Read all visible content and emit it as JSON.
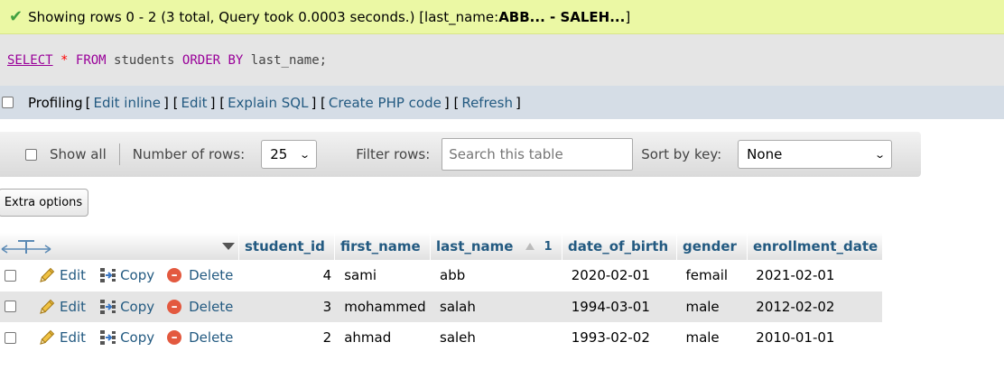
{
  "message": {
    "prefix": "Showing rows 0 - 2 (3 total, Query took 0.0003 seconds.) [last_name: ",
    "range": "ABB... - SALEH...",
    "suffix": "]"
  },
  "sql": {
    "select": "SELECT",
    "star": "*",
    "from": "FROM",
    "table": "students",
    "order_by": "ORDER BY",
    "column": "last_name;"
  },
  "profiling": {
    "label": "Profiling",
    "links": [
      "Edit inline",
      "Edit",
      "Explain SQL",
      "Create PHP code",
      "Refresh"
    ]
  },
  "nav": {
    "show_all": "Show all",
    "rows_label": "Number of rows:",
    "rows_value": "25",
    "filter_label": "Filter rows:",
    "search_placeholder": "Search this table",
    "sort_label": "Sort by key:",
    "sort_value": "None"
  },
  "extra_options": "Extra options",
  "table": {
    "columns": [
      "student_id",
      "first_name",
      "last_name",
      "date_of_birth",
      "gender",
      "enrollment_date"
    ],
    "sort_index": "1",
    "row_actions": {
      "edit": "Edit",
      "copy": "Copy",
      "delete": "Delete"
    },
    "rows": [
      [
        "4",
        "sami",
        "abb",
        "2020-02-01",
        "femail",
        "2021-02-01"
      ],
      [
        "3",
        "mohammed",
        "salah",
        "1994-03-01",
        "male",
        "2012-02-02"
      ],
      [
        "2",
        "ahmad",
        "saleh",
        "1993-02-02",
        "male",
        "2010-01-01"
      ]
    ]
  }
}
